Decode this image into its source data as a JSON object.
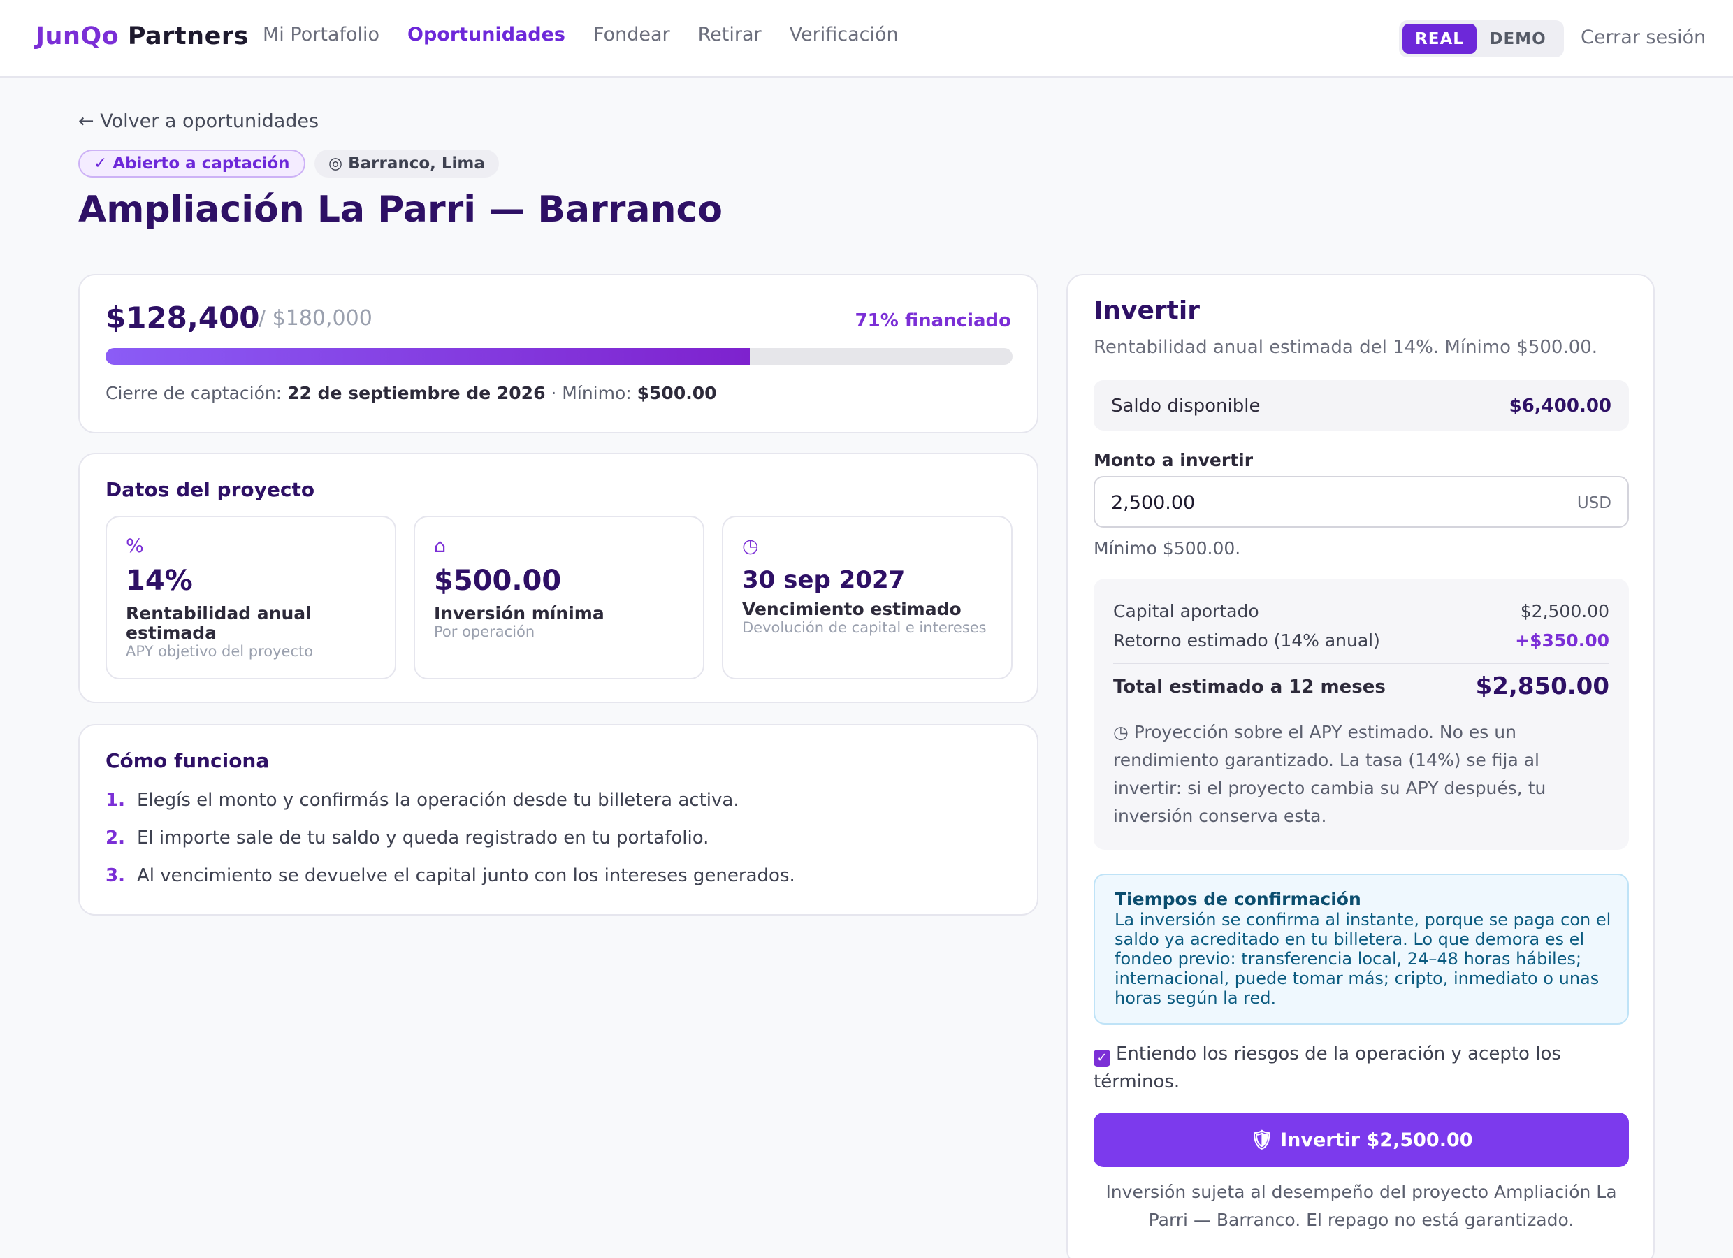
{
  "brand": {
    "part1": "JunQo",
    "part2": "Partners"
  },
  "nav": {
    "items": [
      "Mi Portafolio",
      "Oportunidades",
      "Fondear",
      "Retirar",
      "Verificación"
    ],
    "active": "Oportunidades"
  },
  "mode": {
    "real": "REAL",
    "demo": "DEMO",
    "selected": "REAL"
  },
  "logout": "Cerrar sesión",
  "back": "← Volver a oportunidades",
  "badges": {
    "status": "✓ Abierto a captación",
    "location": "◎ Barranco, Lima"
  },
  "title": "Ampliación La Parri — Barranco",
  "funding": {
    "raised": "$128,400",
    "goal": "/ $180,000",
    "percent_label": "71% financiado",
    "progress": 0.71,
    "close_label": "Cierre de captación:",
    "close_date": "22 de septiembre de 2026",
    "min_label": " · Mínimo: ",
    "min_value": "$500.00"
  },
  "datos": {
    "title": "Datos del proyecto",
    "stats": [
      {
        "icon": "%",
        "value": "14%",
        "label": "Rentabilidad anual estimada",
        "sub": "APY objetivo del proyecto"
      },
      {
        "icon": "⌂",
        "value": "$500.00",
        "label": "Inversión mínima",
        "sub": "Por operación"
      },
      {
        "icon": "◷",
        "value": "30 sep 2027",
        "label": "Vencimiento estimado",
        "sub": "Devolución de capital e intereses"
      }
    ]
  },
  "como": {
    "title": "Cómo funciona",
    "steps": [
      {
        "n": "1.",
        "text": "Elegís el monto y confirmás la operación desde tu billetera activa."
      },
      {
        "n": "2.",
        "text": "El importe sale de tu saldo y queda registrado en tu portafolio."
      },
      {
        "n": "3.",
        "text": "Al vencimiento se devuelve el capital junto con los intereses generados."
      }
    ]
  },
  "invest": {
    "title": "Invertir",
    "subtitle": "Rentabilidad anual estimada del 14%. Mínimo $500.00.",
    "balance_label": "Saldo disponible",
    "balance_value": "$6,400.00",
    "amount_label": "Monto a invertir",
    "amount_value": "2,500.00",
    "currency": "USD",
    "amount_hint": "Mínimo $500.00.",
    "capital_label": "Capital aportado",
    "capital_value": "$2,500.00",
    "return_label": "Retorno estimado (14% anual)",
    "return_value": "+$350.00",
    "total_label": "Total estimado a 12 meses",
    "total_value": "$2,850.00",
    "projection_note": "◷ Proyección sobre el APY estimado. No es un rendimiento garantizado. La tasa (14%) se fija al invertir: si el proyecto cambia su APY después, tu inversión conserva esta.",
    "confirm_title": "Tiempos de confirmación",
    "confirm_text": "La inversión se confirma al instante, porque se paga con el saldo ya acreditado en tu billetera. Lo que demora es el fondeo previo: transferencia local, 24–48 horas hábiles; internacional, puede tomar más; cripto, inmediato o unas horas según la red.",
    "terms": "Entiendo los riesgos de la operación y acepto los términos.",
    "terms_checked": true,
    "cta": "🛡 Invertir $2,500.00",
    "disclaimer": "Inversión sujeta al desempeño del proyecto Ampliación La Parri — Barranco. El repago no está garantizado."
  },
  "colors": {
    "accent": "#7c3aed",
    "title": "#2e1065",
    "info_bg": "#eff8fe"
  }
}
